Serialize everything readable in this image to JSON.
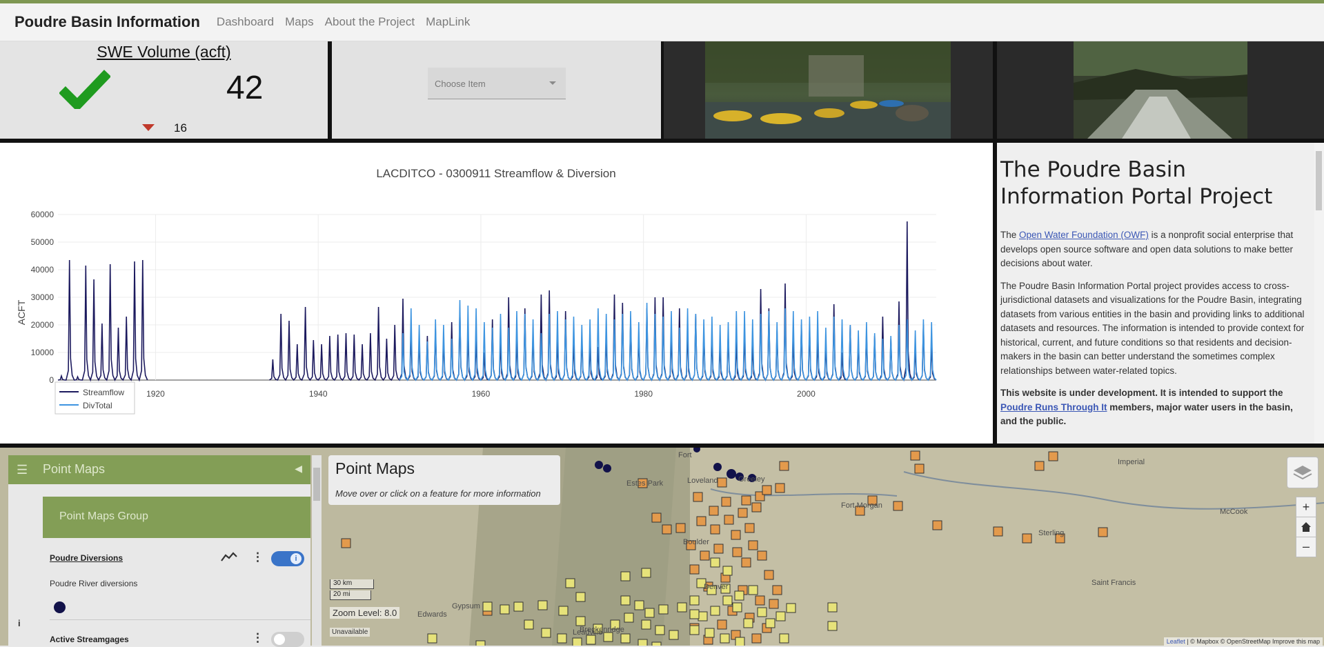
{
  "navbar": {
    "brand": "Poudre Basin Information",
    "links": [
      "Dashboard",
      "Maps",
      "About the Project",
      "MapLink"
    ]
  },
  "swe": {
    "title": "SWE Volume (acft)",
    "value": "42",
    "change": "16",
    "status_icon": "check-icon",
    "trend_icon": "triangle-down-icon",
    "status_color": "#1f9b1f",
    "trend_color": "#c0392b"
  },
  "dropdown": {
    "placeholder": "Choose Item"
  },
  "chart_data": {
    "type": "line",
    "title": "LACDITCO - 0300911 Streamflow & Diversion",
    "xlabel": "",
    "ylabel": "ACFT",
    "ylim": [
      0,
      60000
    ],
    "xlim": [
      1908,
      2016
    ],
    "x_ticks": [
      1920,
      1940,
      1960,
      1980,
      2000
    ],
    "y_ticks": [
      0,
      10000,
      20000,
      30000,
      40000,
      50000,
      60000
    ],
    "grid": true,
    "legend": "bottom-left",
    "series": [
      {
        "name": "Streamflow",
        "color": "#1c1a5e",
        "segments": [
          {
            "start_year": 1908,
            "peaks": [
              1500,
              43500,
              1200,
              41500,
              36500,
              20500,
              42000,
              19000,
              23000,
              43000,
              43500
            ]
          },
          {
            "start_year": 1934,
            "peaks": [
              7500,
              24000,
              21500,
              13000,
              26500,
              14500,
              13000,
              16000,
              16500,
              17000,
              16500,
              13000,
              17000,
              26500,
              15000,
              20000,
              29500,
              17000,
              15000,
              16000,
              18500,
              15000,
              21000,
              26000,
              17000,
              15000,
              10000,
              22000,
              14000,
              30000,
              15000,
              26000,
              17000,
              31000,
              32500,
              15000,
              25000,
              14000,
              16000,
              13000,
              12000,
              16000,
              31000,
              28000,
              22000,
              16000,
              26000,
              30000,
              30000,
              17000,
              26000,
              18000,
              24000,
              17000,
              16000,
              13000,
              17000,
              14000,
              17000,
              13000,
              33000,
              26000,
              18000,
              35000,
              15000,
              20000,
              19000,
              15000,
              13000,
              27500,
              10000,
              20000,
              14000,
              17000,
              16000,
              23000,
              15000,
              28500,
              57500,
              12000,
              20000,
              13000
            ]
          }
        ]
      },
      {
        "name": "DivTotal",
        "color": "#3d94e0",
        "segments": [
          {
            "start_year": 1950,
            "peaks": [
              17000,
              26000,
              20000,
              14000,
              22000,
              20000,
              15000,
              29000,
              27000,
              26000,
              21000,
              19000,
              24000,
              19000,
              25000,
              24000,
              22000,
              17000,
              24000,
              25000,
              22000,
              23000,
              20000,
              22000,
              26000,
              24000,
              22000,
              24000,
              25000,
              21000,
              28000,
              24000,
              23000,
              25000,
              19000,
              26000,
              24000,
              22000,
              23000,
              20000,
              21000,
              25000,
              25000,
              22000,
              24000,
              25000,
              21000,
              26000,
              25000,
              22000,
              23000,
              25000,
              19000,
              23000,
              22000,
              20000,
              18000,
              21000,
              17000,
              15000,
              16000,
              20000,
              22000,
              18000,
              22000,
              21000
            ]
          }
        ]
      }
    ]
  },
  "info": {
    "heading": "The Poudre Basin Information Portal Project",
    "p1_before": "The ",
    "p1_link": "Open Water Foundation (OWF)",
    "p1_after": " is a nonprofit social enterprise that develops open source software and open data solutions to make better decisions about water.",
    "p2": "The Poudre Basin Information Portal project provides access to cross-jurisdictional datasets and visualizations for the Poudre Basin, integrating datasets from various entities in the basin and providing links to additional datasets and resources. The information is intended to provide context for historical, current, and future conditions so that residents and decision-makers in the basin can better understand the sometimes complex relationships between water-related topics.",
    "p3_before": "This website is under development. It is intended to support the ",
    "p3_link": "Poudre Runs Through It",
    "p3_after": " members, major water users in the basin, and the public."
  },
  "sidebar": {
    "title": "Point Maps",
    "group": "Point Maps Group",
    "layer1": {
      "name": "Poudre Diversions",
      "description": "Poudre River diversions"
    },
    "layer2": {
      "name": "Active Streamgages"
    }
  },
  "map": {
    "info_title": "Point Maps",
    "info_subtitle": "Move over or click on a feature for more information",
    "scale_km": "30 km",
    "scale_mi": "20 mi",
    "zoom_level": "Zoom Level: 8.0",
    "unavailable": "Unavailable",
    "attribution_leaflet": "Leaflet",
    "attribution_rest": "| © Mapbox © OpenStreetMap Improve this map",
    "places": [
      "Fort",
      "Estes Park",
      "Loveland",
      "Greeley",
      "Boulder",
      "Denver",
      "Fort Morgan",
      "Sterling",
      "Imperial",
      "McCook",
      "Saint Francis",
      "Gypsum",
      "Edwards",
      "Leadville",
      "Breckenridge"
    ]
  }
}
